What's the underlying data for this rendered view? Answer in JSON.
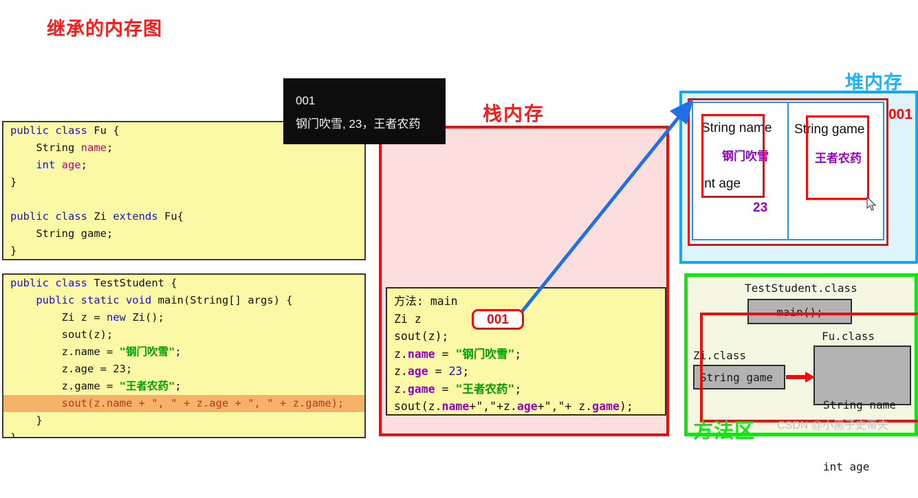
{
  "page": {
    "title": "继承的内存图",
    "watermark": "CSDN @小黑子史蒂夫"
  },
  "code_classes": {
    "lines": [
      "public class Fu {",
      "    String name;",
      "    int age;",
      "}",
      "",
      "public class Zi extends Fu{",
      "    String game;",
      "}"
    ]
  },
  "code_test": {
    "lines": [
      "public class TestStudent {",
      "    public static void main(String[] args) {",
      "        Zi z = new Zi();",
      "        sout(z);",
      "        z.name = \"钢门吹雪\";",
      "        z.age = 23;",
      "        z.game = \"王者农药\";",
      "        sout(z.name + \", \" + z.age + \", \" + z.game);",
      "    }",
      "}"
    ],
    "highlighted_line_index": 7
  },
  "console": {
    "line1": "001",
    "line2": "钢门吹雪, 23，王者农药"
  },
  "stack": {
    "label": "栈内存",
    "frame_lines": [
      "方法: main",
      "Zi z",
      "sout(z);",
      "z.name = \"钢门吹雪\";",
      "z.age = 23;",
      "z.game = \"王者农药\";",
      "sout(z.name+\",\"+z.age+\",\"+ z.game);"
    ],
    "reference_value": "001"
  },
  "heap": {
    "label": "堆内存",
    "address": "001",
    "fu_part": {
      "field1_name": "String name",
      "field1_value": "钢门吹雪",
      "field2_name": "int age",
      "field2_value": "23"
    },
    "zi_part": {
      "field1_name": "String game",
      "field1_value": "王者农药"
    }
  },
  "method_area": {
    "label": "方法区",
    "test_class_name": "TestStudent.class",
    "test_class_member": "main();",
    "zi_class_name": "Zi.class",
    "zi_class_member": "String game",
    "fu_class_name": "Fu.class",
    "fu_class_member_1": "String name",
    "fu_class_member_2": "int age"
  },
  "colors": {
    "title_red": "#ff1a1a",
    "stack_red": "#f90707",
    "heap_blue": "#12a7f5",
    "method_green": "#12e612",
    "value_purple": "#9600c8",
    "string_green": "#00a000"
  }
}
